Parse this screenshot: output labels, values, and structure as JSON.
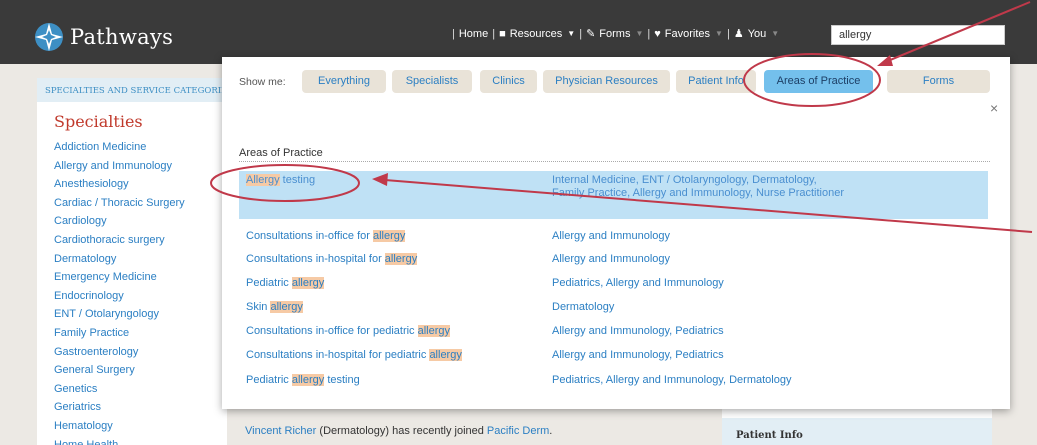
{
  "header": {
    "brand": "Pathways",
    "nav": [
      {
        "label": "Home",
        "icon": "",
        "caret": false
      },
      {
        "label": "Resources",
        "icon": "book-icon",
        "caret": true
      },
      {
        "label": "Forms",
        "icon": "edit-icon",
        "caret": true
      },
      {
        "label": "Favorites",
        "icon": "heart-icon",
        "caret": true
      },
      {
        "label": "You",
        "icon": "user-icon",
        "caret": true
      }
    ],
    "search_value": "allergy"
  },
  "sidebar": {
    "heading": "SPECIALTIES AND SERVICE CATEGORIES",
    "title": "Specialties",
    "items": [
      "Addiction Medicine",
      "Allergy and Immunology",
      "Anesthesiology",
      "Cardiac / Thoracic Surgery",
      "Cardiology",
      "Cardiothoracic surgery",
      "Dermatology",
      "Emergency Medicine",
      "Endocrinology",
      "ENT / Otolaryngology",
      "Family Practice",
      "Gastroenterology",
      "General Surgery",
      "Genetics",
      "Geriatrics",
      "Hematology",
      "Home Health"
    ]
  },
  "dropdown": {
    "show_me_label": "Show me:",
    "filters": [
      "Everything",
      "Specialists",
      "Clinics",
      "Physician Resources",
      "Patient Info",
      "Areas of Practice",
      "Forms"
    ],
    "active_filter": "Areas of Practice",
    "close_label": "×",
    "section_label": "Areas of Practice",
    "results": [
      {
        "pre": "",
        "hit": "Allergy",
        "post": " testing",
        "categories": "Internal Medicine, ENT / Otolaryngology, Dermatology, Family Practice, Allergy and Immunology, Nurse Practitioner",
        "highlighted": true
      },
      {
        "pre": "Consultations in-office for ",
        "hit": "allergy",
        "post": "",
        "categories": "Allergy and Immunology"
      },
      {
        "pre": "Consultations in-hospital for ",
        "hit": "allergy",
        "post": "",
        "categories": "Allergy and Immunology"
      },
      {
        "pre": "Pediatric ",
        "hit": "allergy",
        "post": "",
        "categories": "Pediatrics, Allergy and Immunology"
      },
      {
        "pre": "Skin ",
        "hit": "allergy",
        "post": "",
        "categories": "Dermatology"
      },
      {
        "pre": "Consultations in-office for pediatric ",
        "hit": "allergy",
        "post": "",
        "categories": "Allergy and Immunology, Pediatrics"
      },
      {
        "pre": "Consultations in-hospital for pediatric ",
        "hit": "allergy",
        "post": "",
        "categories": "Allergy and Immunology, Pediatrics"
      },
      {
        "pre": "Pediatric ",
        "hit": "allergy",
        "post": " testing",
        "categories": "Pediatrics, Allergy and Immunology, Dermatology"
      }
    ]
  },
  "news": {
    "person": "Vincent Richer",
    "specialty": " (Dermatology) has recently joined ",
    "clinic": "Pacific Derm",
    "end": "."
  },
  "right_panel": {
    "label": "Patient Info"
  },
  "colors": {
    "accent": "#2b7fc3",
    "active_filter": "#74c0ec",
    "annotation": "#c0394a",
    "topbar": "#3a3a3a"
  }
}
